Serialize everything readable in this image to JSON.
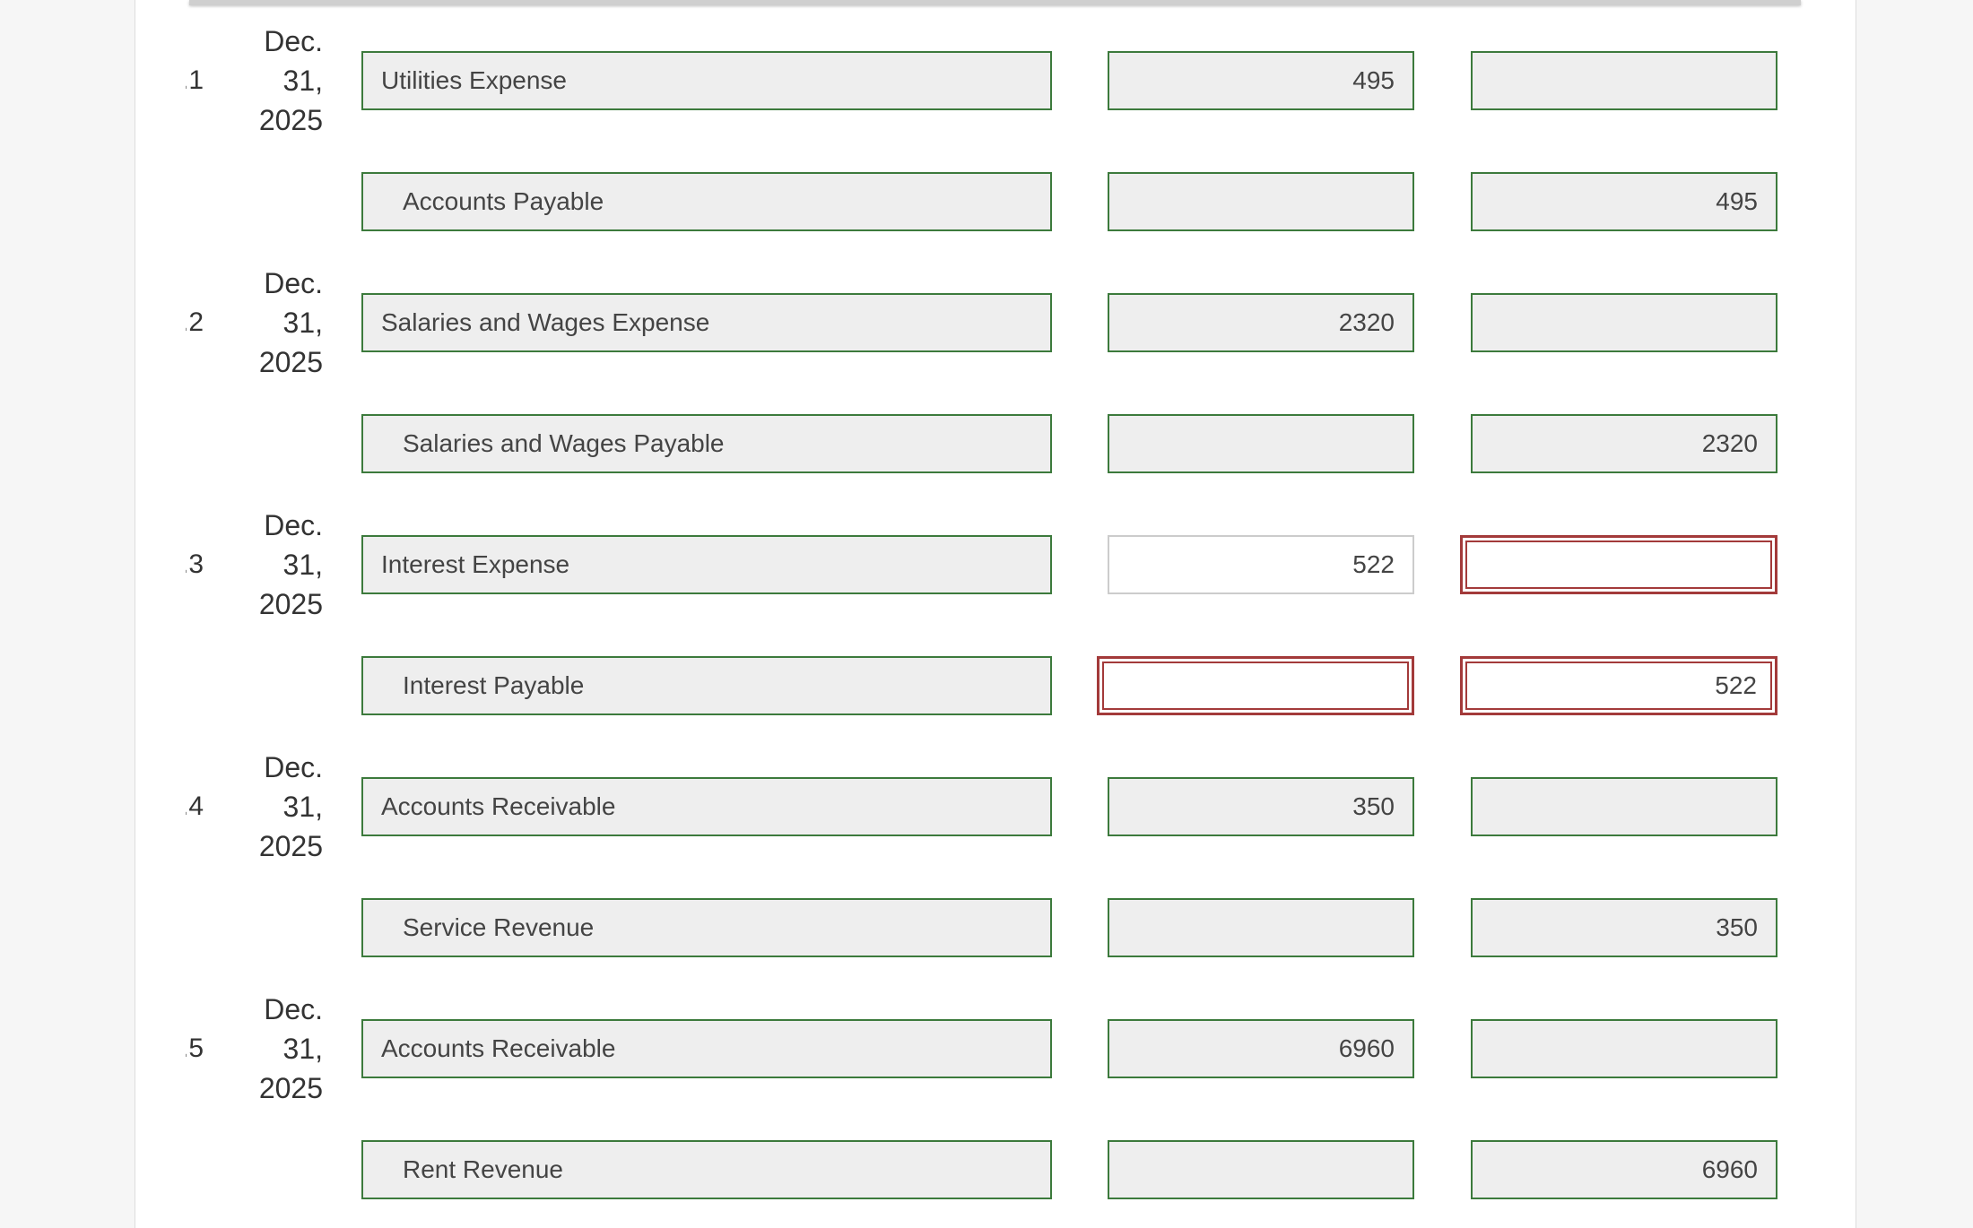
{
  "entries": [
    {
      "number": "1.",
      "date": {
        "month": "Dec.",
        "day": "31,",
        "year": "2025"
      },
      "debit_line": {
        "account": "Utilities Expense",
        "debit": "495",
        "credit": ""
      },
      "credit_line": {
        "account": "Accounts Payable",
        "debit": "",
        "credit": "495"
      }
    },
    {
      "number": "2.",
      "date": {
        "month": "Dec.",
        "day": "31,",
        "year": "2025"
      },
      "debit_line": {
        "account": "Salaries and Wages Expense",
        "debit": "2320",
        "credit": ""
      },
      "credit_line": {
        "account": "Salaries and Wages Payable",
        "debit": "",
        "credit": "2320"
      }
    },
    {
      "number": "3.",
      "date": {
        "month": "Dec.",
        "day": "31,",
        "year": "2025"
      },
      "debit_line": {
        "account": "Interest Expense",
        "debit": "522",
        "credit": ""
      },
      "credit_line": {
        "account": "Interest Payable",
        "debit": "",
        "credit": "522"
      }
    },
    {
      "number": "4.",
      "date": {
        "month": "Dec.",
        "day": "31,",
        "year": "2025"
      },
      "debit_line": {
        "account": "Accounts Receivable",
        "debit": "350",
        "credit": ""
      },
      "credit_line": {
        "account": "Service Revenue",
        "debit": "",
        "credit": "350"
      }
    },
    {
      "number": "5.",
      "date": {
        "month": "Dec.",
        "day": "31,",
        "year": "2025"
      },
      "debit_line": {
        "account": "Accounts Receivable",
        "debit": "6960",
        "credit": ""
      },
      "credit_line": {
        "account": "Rent Revenue",
        "debit": "",
        "credit": "6960"
      }
    }
  ],
  "colors": {
    "correct_border": "#3c7a3c",
    "incorrect_border": "#a33a3a",
    "field_fill": "#eeeeee"
  }
}
